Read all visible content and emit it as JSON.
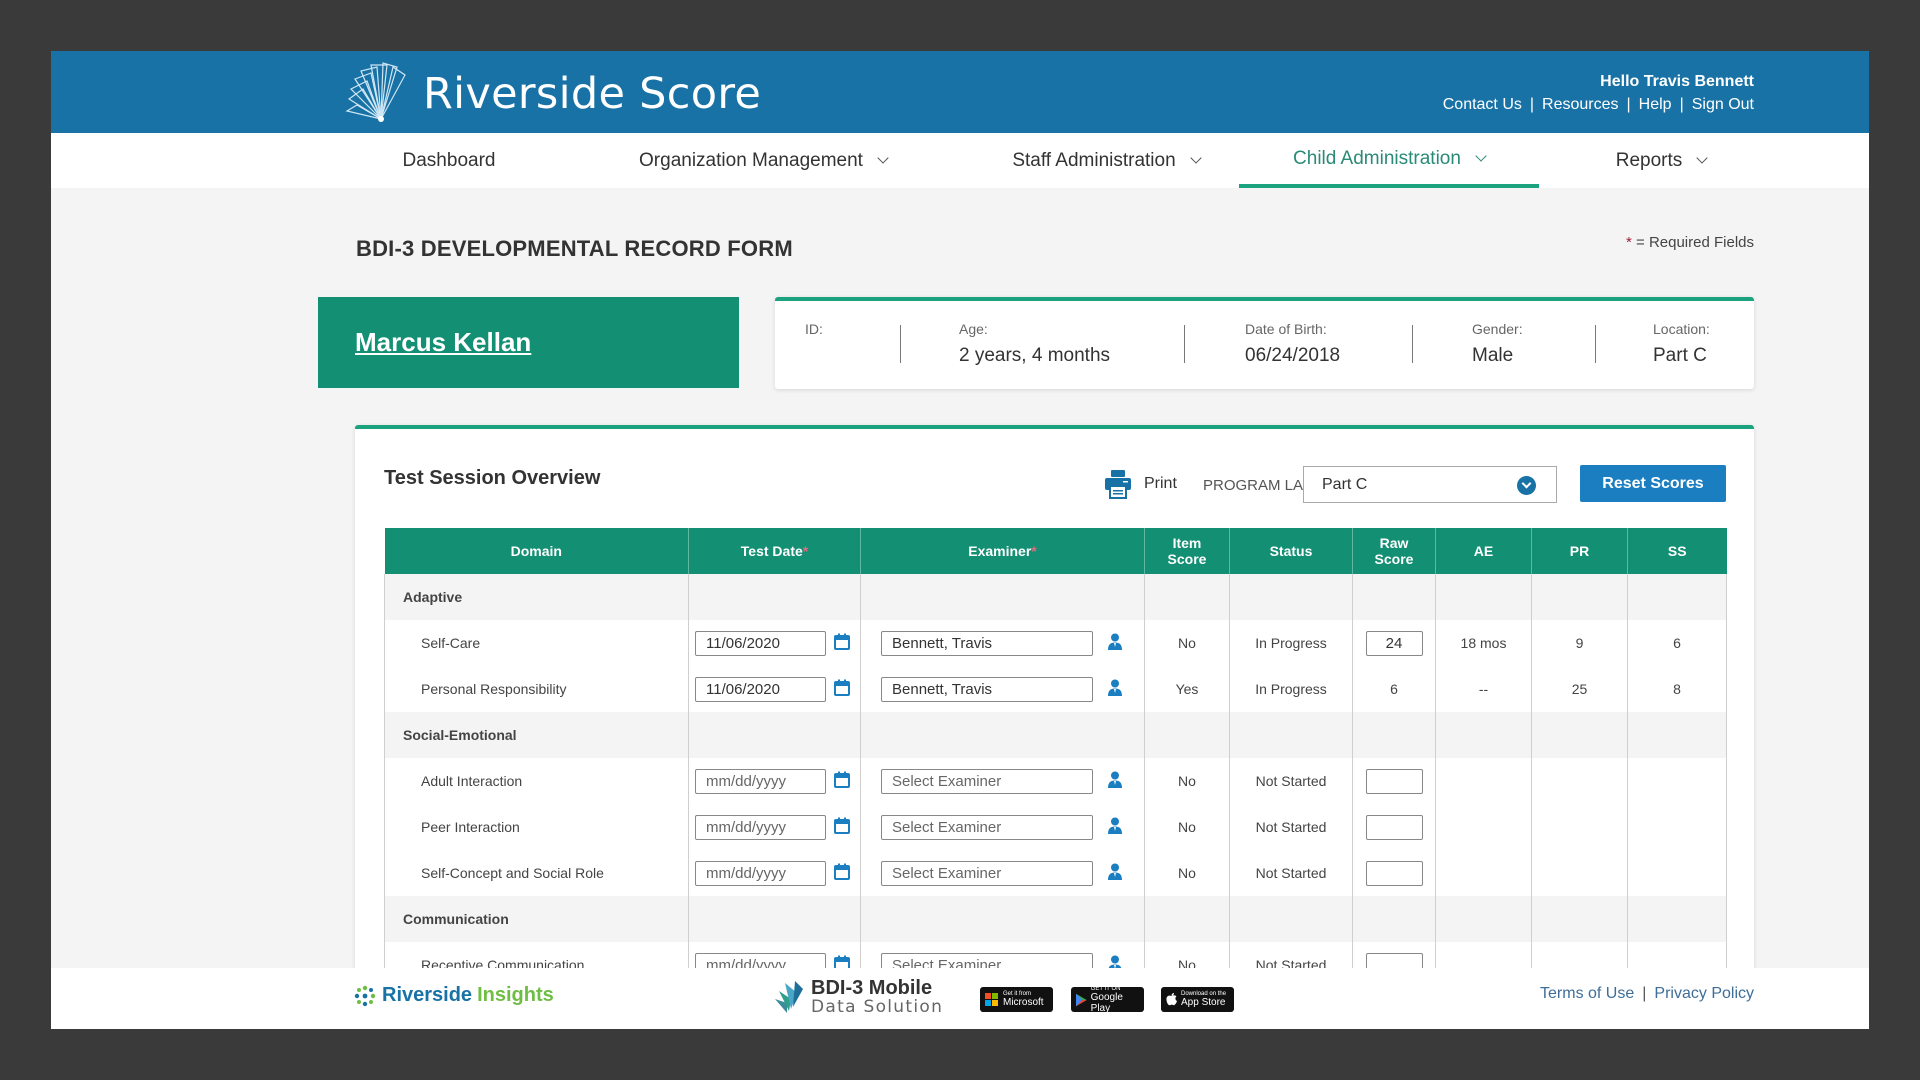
{
  "header": {
    "app_title": "Riverside Score",
    "greeting": "Hello Travis Bennett",
    "links": [
      "Contact Us",
      "Resources",
      "Help",
      "Sign Out"
    ]
  },
  "nav": {
    "items": [
      {
        "label": "Dashboard",
        "has_dropdown": false,
        "active": false
      },
      {
        "label": "Organization Management",
        "has_dropdown": true,
        "active": false
      },
      {
        "label": "Staff Administration",
        "has_dropdown": true,
        "active": false
      },
      {
        "label": "Child Administration",
        "has_dropdown": true,
        "active": true
      },
      {
        "label": "Reports",
        "has_dropdown": true,
        "active": false
      }
    ]
  },
  "page": {
    "title": "BDI-3 DEVELOPMENTAL RECORD FORM",
    "required_star": "*",
    "required_note": " = Required Fields"
  },
  "child": {
    "name": "Marcus Kellan",
    "fields": [
      {
        "label": "ID:",
        "value": ""
      },
      {
        "label": "Age:",
        "value": "2 years, 4 months"
      },
      {
        "label": "Date of Birth:",
        "value": "06/24/2018"
      },
      {
        "label": "Gender:",
        "value": "Male"
      },
      {
        "label": "Location:",
        "value": "Part C"
      }
    ]
  },
  "session": {
    "title": "Test Session Overview",
    "print_label": "Print",
    "program_label": "PROGRAM LABEL",
    "program_value": "Part C",
    "reset_label": "Reset Scores",
    "columns": {
      "domain": "Domain",
      "test_date": "Test Date",
      "examiner": "Examiner",
      "item_score_1": "Item",
      "item_score_2": "Score",
      "status": "Status",
      "raw_score_1": "Raw",
      "raw_score_2": "Score",
      "ae": "AE",
      "pr": "PR",
      "ss": "SS",
      "required_mark": "*"
    },
    "groups": [
      {
        "name": "Adaptive",
        "rows": [
          {
            "name": "Self-Care",
            "date": "11/06/2020",
            "date_placeholder": "mm/dd/yyyy",
            "examiner": "Bennett, Travis",
            "examiner_placeholder": "Select Examiner",
            "item_score": "No",
            "status": "In Progress",
            "raw": "24",
            "raw_editable": true,
            "ae": "18 mos",
            "pr": "9",
            "ss": "6"
          },
          {
            "name": "Personal Responsibility",
            "date": "11/06/2020",
            "date_placeholder": "mm/dd/yyyy",
            "examiner": "Bennett, Travis",
            "examiner_placeholder": "Select Examiner",
            "item_score": "Yes",
            "status": "In Progress",
            "raw": "6",
            "raw_editable": false,
            "ae": "--",
            "pr": "25",
            "ss": "8"
          }
        ]
      },
      {
        "name": "Social-Emotional",
        "rows": [
          {
            "name": "Adult Interaction",
            "date": "",
            "date_placeholder": "mm/dd/yyyy",
            "examiner": "",
            "examiner_placeholder": "Select Examiner",
            "item_score": "No",
            "status": "Not Started",
            "raw": "",
            "raw_editable": true,
            "ae": "",
            "pr": "",
            "ss": ""
          },
          {
            "name": "Peer Interaction",
            "date": "",
            "date_placeholder": "mm/dd/yyyy",
            "examiner": "",
            "examiner_placeholder": "Select Examiner",
            "item_score": "No",
            "status": "Not Started",
            "raw": "",
            "raw_editable": true,
            "ae": "",
            "pr": "",
            "ss": ""
          },
          {
            "name": "Self-Concept and Social Role",
            "date": "",
            "date_placeholder": "mm/dd/yyyy",
            "examiner": "",
            "examiner_placeholder": "Select Examiner",
            "item_score": "No",
            "status": "Not Started",
            "raw": "",
            "raw_editable": true,
            "ae": "",
            "pr": "",
            "ss": ""
          }
        ]
      },
      {
        "name": "Communication",
        "rows": [
          {
            "name": "Receptive Communication",
            "date": "",
            "date_placeholder": "mm/dd/yyyy",
            "examiner": "",
            "examiner_placeholder": "Select Examiner",
            "item_score": "No",
            "status": "Not Started",
            "raw": "",
            "raw_editable": true,
            "ae": "",
            "pr": "",
            "ss": ""
          }
        ]
      }
    ]
  },
  "footer": {
    "brand_left_1": "Riverside",
    "brand_left_2": "Insights",
    "bdi_line1": "BDI-3 Mobile",
    "bdi_line2": "Data Solution",
    "stores": [
      {
        "small": "Get it from",
        "big": "Microsoft"
      },
      {
        "small": "GET IT ON",
        "big": "Google Play"
      },
      {
        "small": "Download on the",
        "big": "App Store"
      }
    ],
    "links": [
      "Terms of Use",
      "Privacy Policy"
    ]
  },
  "colors": {
    "header_blue": "#1872a6",
    "brand_green": "#138f74",
    "accent_green": "#1ba37f",
    "button_blue": "#1b7ec0",
    "required_red": "#a0203c"
  }
}
